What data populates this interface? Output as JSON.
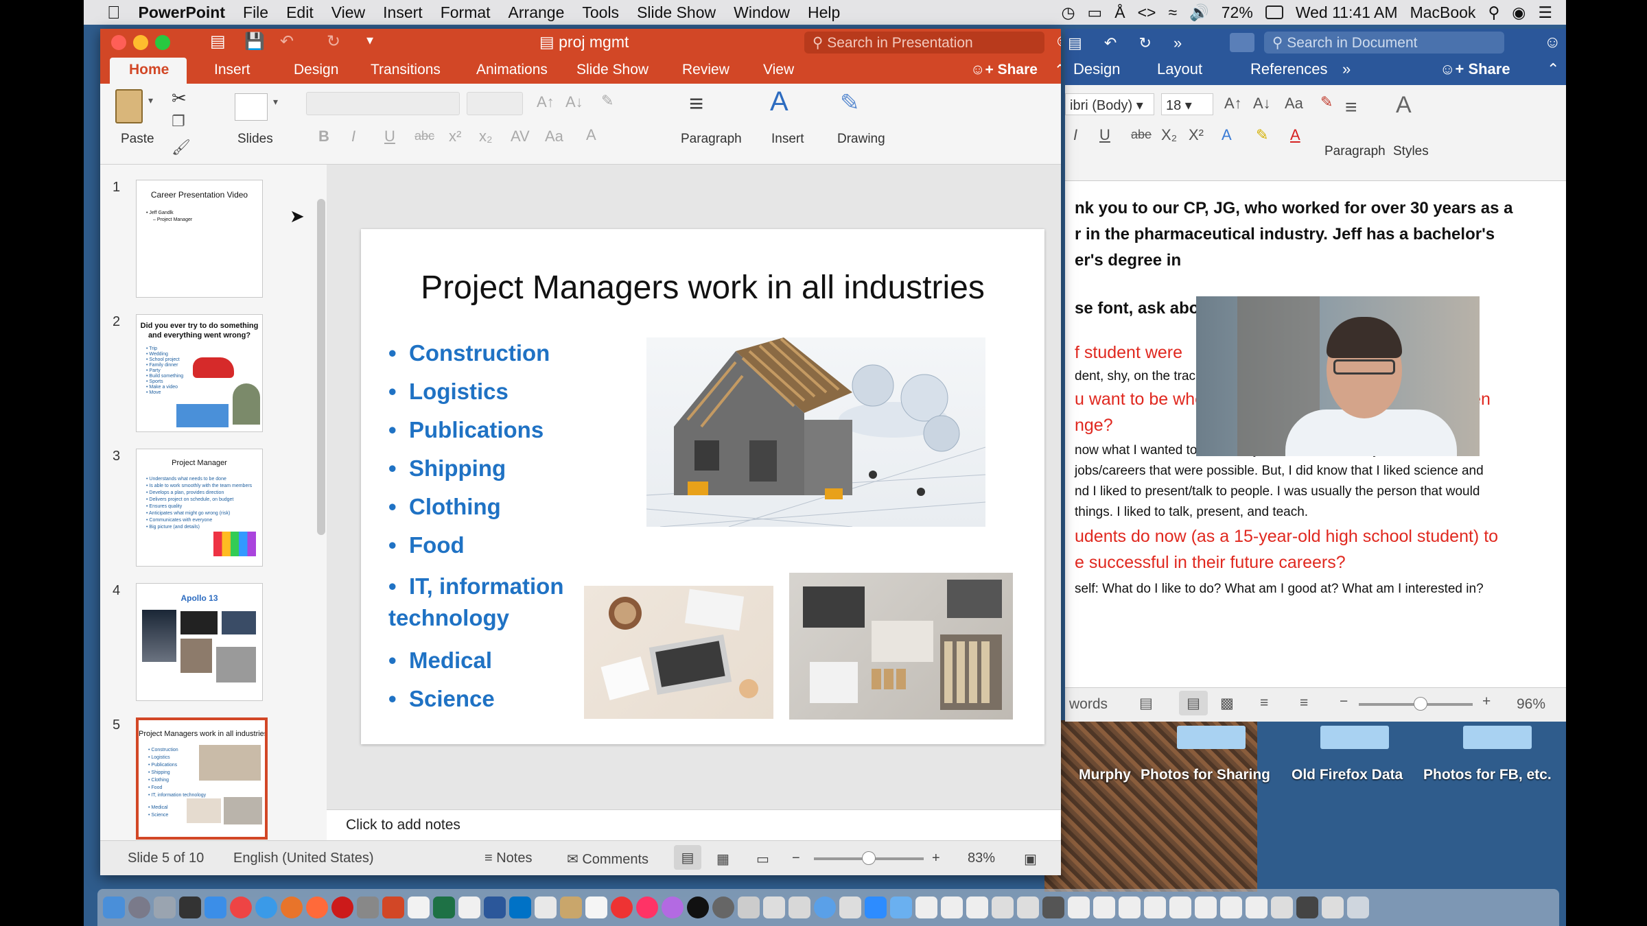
{
  "menubar": {
    "app": "PowerPoint",
    "items": [
      "File",
      "Edit",
      "View",
      "Insert",
      "Format",
      "Arrange",
      "Tools",
      "Slide Show",
      "Window",
      "Help"
    ],
    "battery": "72%",
    "clock": "Wed 11:41 AM",
    "computer_name": "MacBook"
  },
  "ppt": {
    "doc_title": "proj mgmt",
    "search_placeholder": "Search in Presentation",
    "tabs": [
      "Home",
      "Insert",
      "Design",
      "Transitions",
      "Animations",
      "Slide Show",
      "Review",
      "View"
    ],
    "share": "Share",
    "ribbon": {
      "paste": "Paste",
      "slides": "Slides",
      "paragraph": "Paragraph",
      "insert": "Insert",
      "drawing": "Drawing",
      "format_buttons": [
        "B",
        "I",
        "U",
        "abc",
        "x²",
        "x₂"
      ]
    },
    "thumbs": [
      {
        "num": "1",
        "title": "Career Presentation Video",
        "bullets": [
          "• Jeff Gandlk",
          "– Project Manager"
        ]
      },
      {
        "num": "2",
        "title": "Did you ever try to do something",
        "title2": "and everything went wrong?",
        "bullets": [
          "• Trip",
          "• Wedding",
          "• School project",
          "• Family dinner",
          "• Party",
          "• Build something",
          "• Sports",
          "• Make a video",
          "• Move"
        ]
      },
      {
        "num": "3",
        "title": "Project Manager",
        "bullets": [
          "• Understands what needs to be done",
          "• Is able to work smoothly with the team members",
          "• Develops a plan, provides direction",
          "• Delivers project on schedule, on budget",
          "• Ensures quality",
          "• Anticipates what might go wrong (risk)",
          "• Communicates with everyone",
          "• Big picture (and details)"
        ]
      },
      {
        "num": "4",
        "title": "Apollo 13"
      },
      {
        "num": "5",
        "title": "Project Managers work in all industries",
        "bullets": [
          "• Construction",
          "• Logistics",
          "• Publications",
          "• Shipping",
          "• Clothing",
          "• Food",
          "• IT, information technology",
          "• Medical",
          "• Science"
        ]
      }
    ],
    "slide": {
      "title": "Project Managers work in all industries",
      "bullets": [
        "Construction",
        "Logistics",
        "Publications",
        "Shipping",
        "Clothing",
        "Food",
        "IT, information technology",
        "Medical",
        "Science"
      ]
    },
    "notes_placeholder": "Click to add notes",
    "status": {
      "slide_count": "Slide 5 of 10",
      "language": "English (United States)",
      "notes": "Notes",
      "comments": "Comments",
      "zoom": "83%"
    }
  },
  "word": {
    "search_placeholder": "Search in Document",
    "tabs": [
      "Design",
      "Layout",
      "References"
    ],
    "share": "Share",
    "font": "ibri (Body)",
    "size": "18",
    "paragraph": "Paragraph",
    "styles": "Styles",
    "lines": [
      {
        "text": "nk you to our CP, JG, who worked for over 30 years as a",
        "style": "wb"
      },
      {
        "text": "r in the pharmaceutical industry. Jeff has a bachelor's",
        "style": "wb"
      },
      {
        "text": "er's degree in",
        "style": "wb"
      },
      {
        "text": "se font, ask abo",
        "style": "wb"
      },
      {
        "text": "f student were",
        "style": "wr"
      },
      {
        "text": "dent, shy, on the track team",
        "style": "ws"
      },
      {
        "text": "u want to be when you were “our” age? How and when",
        "style": "wr"
      },
      {
        "text": "nge?",
        "style": "wr"
      },
      {
        "text": "now what I wanted to be exactly since I didn't know yet all of the",
        "style": "ws"
      },
      {
        "text": " jobs/careers that were possible.  But, I did know that I liked science and",
        "style": "ws"
      },
      {
        "text": "nd I liked to present/talk to people.  I was usually the person that would",
        "style": "ws"
      },
      {
        "text": " things.  I liked to talk, present, and teach.",
        "style": "ws"
      },
      {
        "text": "udents do now (as a 15-year-old high school student) to",
        "style": "wr"
      },
      {
        "text": "e successful in their future careers?",
        "style": "wr"
      },
      {
        "text": "self: What do I like to do?  What am I good at?  What am I interested in?",
        "style": "ws"
      }
    ],
    "status_words": "words",
    "zoom": "96%"
  },
  "desktop": {
    "labels": [
      "Murphy",
      "Photos for Sharing",
      "Old Firefox Data",
      "Photos for FB, etc."
    ]
  },
  "colors": {
    "ppt_accent": "#d24726",
    "word_accent": "#2b579a",
    "bullet_blue": "#1f72c4",
    "word_red": "#e0281f"
  }
}
